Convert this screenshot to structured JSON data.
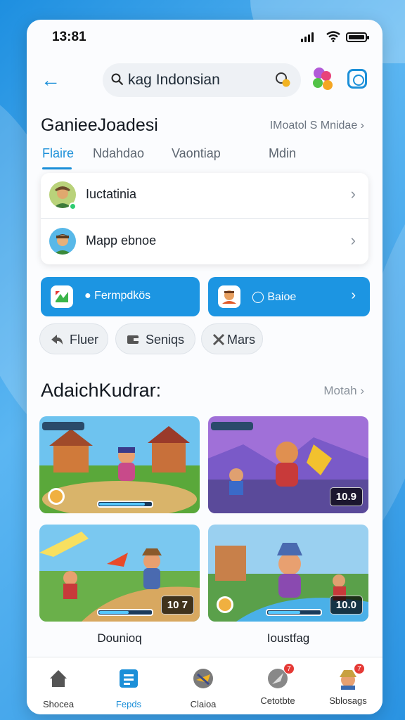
{
  "status": {
    "time": "13:81"
  },
  "search": {
    "value": "kag Indonsian"
  },
  "header": {
    "title": "GanieeJoadesi",
    "right_link": "IMoatol S Mnidae"
  },
  "tabs": [
    {
      "label": "Flaire",
      "active": true
    },
    {
      "label": "Ndahdao",
      "active": false
    },
    {
      "label": "Vaontiap",
      "active": false
    },
    {
      "label": "Mdin",
      "active": false
    }
  ],
  "list": [
    {
      "label": "Iuctatinia"
    },
    {
      "label": "Mapp ebnoe"
    }
  ],
  "buttons": [
    {
      "label": "Fermpdkös"
    },
    {
      "label": "Baioe"
    }
  ],
  "chips": [
    {
      "label": "Fluer"
    },
    {
      "label": "Seniqs"
    },
    {
      "label": "Mars"
    }
  ],
  "section": {
    "title": "AdaichKudrar:",
    "right_link": "Motah"
  },
  "games": [
    {
      "score": "",
      "progress": 0.85
    },
    {
      "score": "10.9",
      "progress": 0
    },
    {
      "score": "10 7",
      "progress": 0.55,
      "label": "Dounioq"
    },
    {
      "score": "10.0",
      "progress": 0.6,
      "label": "Ioustfag"
    }
  ],
  "nav": [
    {
      "label": "Shocea",
      "active": false,
      "badge": ""
    },
    {
      "label": "Fepds",
      "active": true,
      "badge": ""
    },
    {
      "label": "Claioa",
      "active": false,
      "badge": ""
    },
    {
      "label": "Cetotbte",
      "active": false,
      "badge": "7"
    },
    {
      "label": "Sblosags",
      "active": false,
      "badge": "7"
    }
  ],
  "colors": {
    "accent": "#1b8fd8",
    "button": "#1c95e2",
    "badge": "#e53935"
  }
}
